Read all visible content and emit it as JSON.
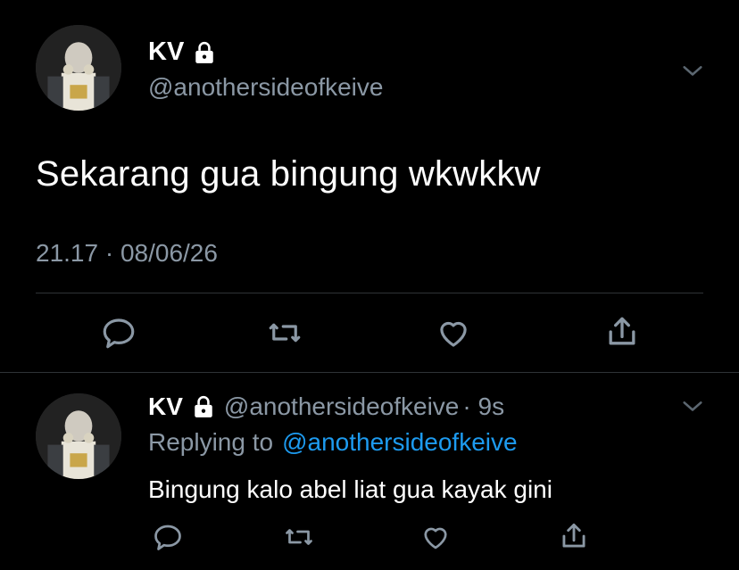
{
  "main_tweet": {
    "display_name": "KV",
    "handle": "@anothersideofkeive",
    "text": "Sekarang gua bingung wkwkkw",
    "timestamp": "21.17 · 08/06/26"
  },
  "reply_tweet": {
    "display_name": "KV",
    "handle": "@anothersideofkeive",
    "age": "· 9s",
    "replying_prefix": "Replying to",
    "replying_handle": "@anothersideofkeive",
    "text": "Bingung kalo abel liat gua kayak gini"
  },
  "icons": {
    "reply": "reply-icon",
    "retweet": "retweet-icon",
    "like": "heart-icon",
    "share": "share-icon",
    "more": "chevron-down-icon",
    "protected": "lock-icon"
  },
  "colors": {
    "background": "#000000",
    "muted_text": "#8b98a5",
    "link": "#1d9bf0",
    "divider": "#2f3336"
  }
}
